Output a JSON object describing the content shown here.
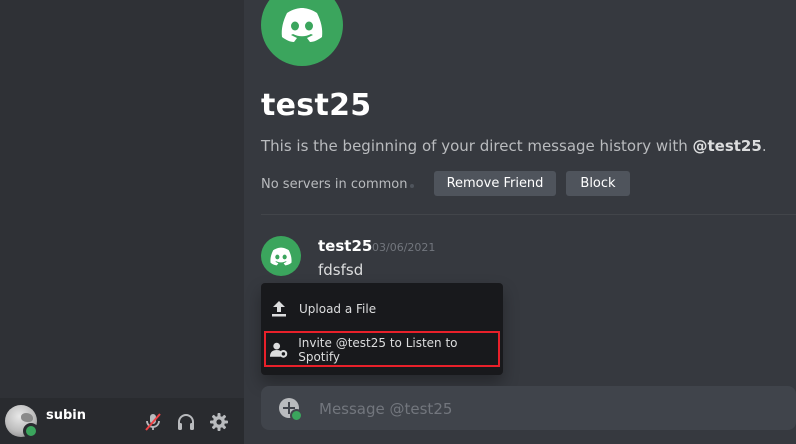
{
  "user_panel": {
    "username": "subin",
    "status_color": "#3ba55d",
    "icons": [
      "mute-mic-icon",
      "headphones-icon",
      "gear-icon"
    ]
  },
  "channel": {
    "title": "test25",
    "intro_prefix": "This is the beginning of your direct message history with ",
    "intro_handle": "@test25",
    "intro_suffix": ".",
    "servers_text": "No servers in common",
    "remove_friend_label": "Remove Friend",
    "block_label": "Block"
  },
  "message": {
    "author": "test25",
    "timestamp": "03/06/2021",
    "content": "fdsfsd"
  },
  "attach_menu": {
    "items": [
      {
        "label": "Upload a File",
        "icon": "upload-icon"
      },
      {
        "label": "Invite @test25 to Listen to Spotify",
        "icon": "invite-user-icon"
      }
    ],
    "highlight_color": "#e8202a"
  },
  "composer": {
    "placeholder": "Message @test25"
  },
  "colors": {
    "accent_green": "#3ba55d",
    "background": "#36393f",
    "sidebar": "#2f3136"
  }
}
